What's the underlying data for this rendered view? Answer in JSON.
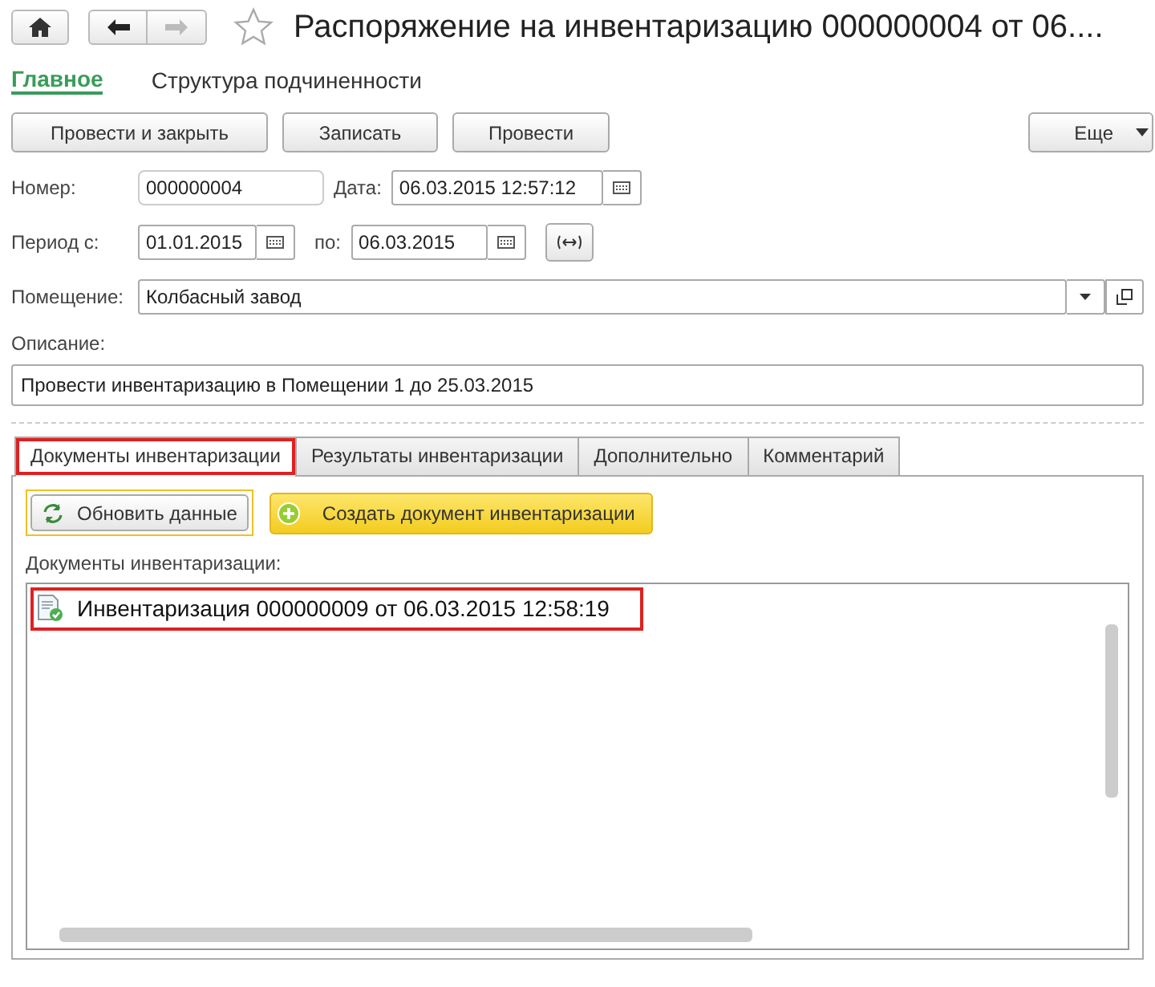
{
  "window": {
    "title": "Распоряжение на инвентаризацию 000000004 от 06...."
  },
  "nav": [
    {
      "label": "Главное",
      "selected": true
    },
    {
      "label": "Структура подчиненности",
      "selected": false
    }
  ],
  "commands": [
    "Провести и закрыть",
    "Записать",
    "Провести"
  ],
  "more": {
    "label": "Еще"
  },
  "fields": {
    "number_label": "Номер:",
    "number": "000000004",
    "date_label": "Дата:",
    "date": "06.03.2015 12:57:12",
    "period_label": "Период с:",
    "period_from": "01.01.2015",
    "period_to_label": "по:",
    "period_to": "06.03.2015",
    "room_label": "Помещение:",
    "room": "Колбасный завод",
    "description_label": "Описание:",
    "description": "Провести инвентаризацию в Помещении 1 до 25.03.2015"
  },
  "tabs": [
    {
      "label": "Документы инвентаризации",
      "selected": true,
      "highlighted": true
    },
    {
      "label": "Результаты инвентаризации",
      "selected": false,
      "highlighted": false
    },
    {
      "label": "Дополнительно",
      "selected": false,
      "highlighted": false
    },
    {
      "label": "Комментарий",
      "selected": false,
      "highlighted": false
    }
  ],
  "panel": {
    "refresh": "Обновить данные",
    "create": "Создать документ инвентаризации",
    "list_label": "Документы инвентаризации:",
    "items": [
      {
        "text": "Инвентаризация 000000009 от 06.03.2015 12:58:19",
        "highlighted": true
      }
    ]
  }
}
